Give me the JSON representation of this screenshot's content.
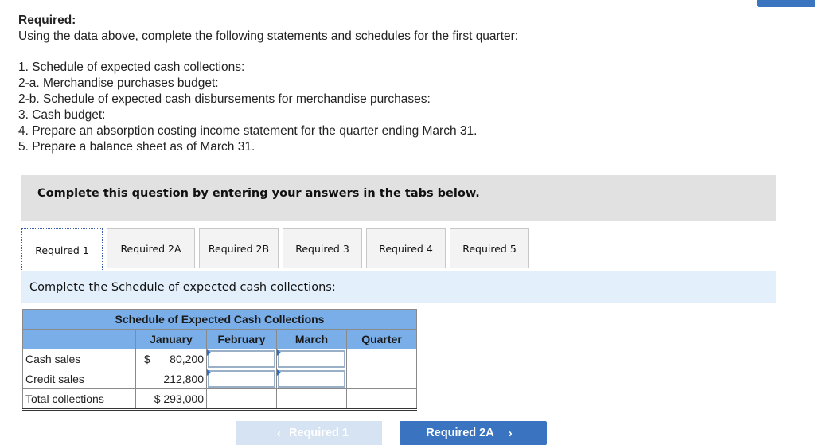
{
  "intro": {
    "title": "Required:",
    "subtitle": "Using the data above, complete the following statements and schedules for the first quarter:",
    "items": [
      "1. Schedule of expected cash collections:",
      "2-a. Merchandise purchases budget:",
      "2-b. Schedule of expected cash disbursements for merchandise purchases:",
      "3. Cash budget:",
      "4. Prepare an absorption costing income statement for the quarter ending March 31.",
      "5. Prepare a balance sheet as of March 31."
    ]
  },
  "banner": "Complete this question by entering your answers in the tabs below.",
  "tabs": [
    {
      "label": "Required 1",
      "active": true
    },
    {
      "label": "Required 2A",
      "active": false
    },
    {
      "label": "Required 2B",
      "active": false
    },
    {
      "label": "Required 3",
      "active": false
    },
    {
      "label": "Required 4",
      "active": false
    },
    {
      "label": "Required 5",
      "active": false
    }
  ],
  "panel": {
    "instruction": "Complete the Schedule of expected cash collections:",
    "table": {
      "title": "Schedule of Expected Cash Collections",
      "columns": [
        "",
        "January",
        "February",
        "March",
        "Quarter"
      ],
      "rows": [
        {
          "label": "Cash sales",
          "january_currency": "$",
          "january": "80,200",
          "february": "",
          "march": "",
          "quarter": ""
        },
        {
          "label": "Credit sales",
          "january_currency": "",
          "january": "212,800",
          "february": "",
          "march": "",
          "quarter": ""
        },
        {
          "label": "Total collections",
          "january_currency": "",
          "january": "$ 293,000",
          "february": "",
          "march": "",
          "quarter": ""
        }
      ]
    }
  },
  "nav": {
    "prev_label": "Required 1",
    "next_label": "Required 2A",
    "prev_icon": "‹",
    "next_icon": "›"
  },
  "colors": {
    "accent": "#3a74c0",
    "table_header": "#7aaee8",
    "panel_bg": "#e3f0fb"
  }
}
